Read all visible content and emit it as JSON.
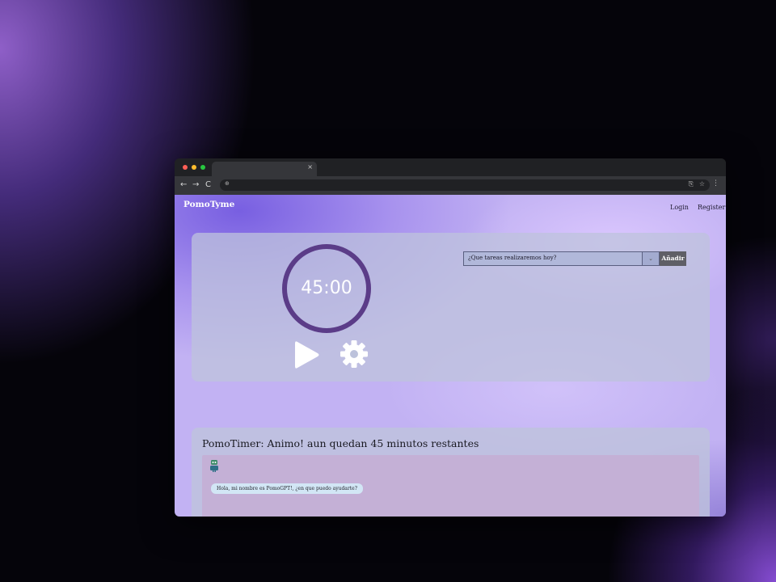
{
  "browser": {
    "tab_close_glyph": "×",
    "back_glyph": "←",
    "forward_glyph": "→",
    "reload_glyph": "C",
    "lock_glyph": "⊕",
    "share_glyph": "⎘",
    "star_glyph": "☆",
    "menu_glyph": "⋮"
  },
  "header": {
    "brand": "PomoTyme",
    "login": "Login",
    "register": "Register"
  },
  "timer": {
    "time": "45:00",
    "ring_color": "#5b3c88",
    "play_icon": "play-icon",
    "settings_icon": "gear-icon"
  },
  "tasks": {
    "select_value": "¿Que tareas realizaremos hoy?",
    "select_arrow": "⌄",
    "add_label": "Añadir"
  },
  "chat": {
    "title": "PomoTimer: Animo! aun quedan 45 minutos restantes",
    "bot_message": "Hola, mi nombre es PomoGPT!, ¿en que puedo ayudarte?",
    "avatar_icon": "robot-avatar-icon"
  },
  "colors": {
    "accent": "#5b3c88",
    "add_button": "#5f5f66",
    "chat_bubble": "#d2e6f5"
  }
}
